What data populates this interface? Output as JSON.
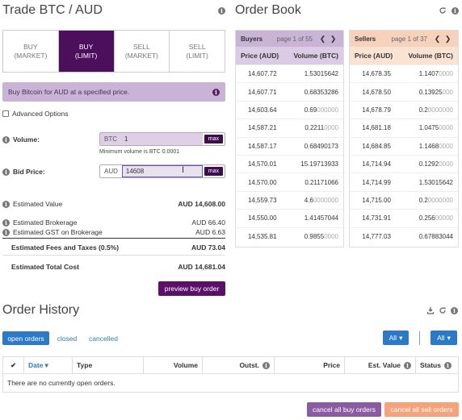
{
  "trade": {
    "title": "Trade BTC / AUD",
    "tabs": [
      {
        "line1": "BUY",
        "line2": "(MARKET)"
      },
      {
        "line1": "BUY",
        "line2": "(LIMIT)"
      },
      {
        "line1": "SELL",
        "line2": "(MARKET)"
      },
      {
        "line1": "SELL",
        "line2": "(LIMIT)"
      }
    ],
    "alert_text": "Buy Bitcoin for AUD at a specified price.",
    "advanced_options_label": "Advanced Options",
    "volume": {
      "label": "Volume:",
      "currency": "BTC",
      "value": "1",
      "max_label": "max",
      "hint": "Minimum volume is BTC 0.0001"
    },
    "bid_price": {
      "label": "Bid Price:",
      "currency": "AUD",
      "value": "14608",
      "max_label": "max"
    },
    "estimated_value": {
      "label": "Estimated Value",
      "value": "AUD 14,608.00"
    },
    "estimated_brokerage": {
      "label": "Estimated Brokerage",
      "value": "AUD 66.40"
    },
    "estimated_gst": {
      "label": "Estimated GST on Brokerage",
      "value": "AUD 6.63"
    },
    "estimated_fees": {
      "label": "Estimated Fees and Taxes (0.5%)",
      "value": "AUD 73.04"
    },
    "estimated_total": {
      "label": "Estimated Total Cost",
      "value": "AUD 14,681.04"
    },
    "preview_button": "preview buy order"
  },
  "order_book": {
    "title": "Order Book",
    "buyers": {
      "title": "Buyers",
      "page": "page 1 of 55",
      "col_price": "Price (AUD)",
      "col_volume": "Volume (BTC)",
      "rows": [
        {
          "price": "14,607.72",
          "vol": "1.53015642",
          "vol_dim": ""
        },
        {
          "price": "14,607.71",
          "vol": "0.68353286",
          "vol_dim": ""
        },
        {
          "price": "14,603.64",
          "vol": "0.69",
          "vol_dim": "000000"
        },
        {
          "price": "14,587.21",
          "vol": "0.2211",
          "vol_dim": "0000"
        },
        {
          "price": "14,587.17",
          "vol": "0.68490173",
          "vol_dim": ""
        },
        {
          "price": "14,570.01",
          "vol": "15.19713933",
          "vol_dim": ""
        },
        {
          "price": "14,570.00",
          "vol": "0.21171066",
          "vol_dim": ""
        },
        {
          "price": "14,559.73",
          "vol": "4.6",
          "vol_dim": "0000000"
        },
        {
          "price": "14,550.00",
          "vol": "1.41457044",
          "vol_dim": ""
        },
        {
          "price": "14,535.81",
          "vol": "0.9855",
          "vol_dim": "0000"
        }
      ]
    },
    "sellers": {
      "title": "Sellers",
      "page": "page 1 of 37",
      "col_price": "Price (AUD)",
      "col_volume": "Volume (BTC)",
      "rows": [
        {
          "price": "14,678.35",
          "vol": "1.1407",
          "vol_dim": "0000"
        },
        {
          "price": "14,678.50",
          "vol": "0.13925",
          "vol_dim": "000"
        },
        {
          "price": "14,678.79",
          "vol": "0.2",
          "vol_dim": "0000000"
        },
        {
          "price": "14,681.18",
          "vol": "1.0475",
          "vol_dim": "0000"
        },
        {
          "price": "14,684.85",
          "vol": "1.1468",
          "vol_dim": "0000"
        },
        {
          "price": "14,714.94",
          "vol": "0.1292",
          "vol_dim": "0000"
        },
        {
          "price": "14,714.99",
          "vol": "1.53015642",
          "vol_dim": ""
        },
        {
          "price": "14,715.00",
          "vol": "0.2",
          "vol_dim": "0000000"
        },
        {
          "price": "14,731.91",
          "vol": "0.256",
          "vol_dim": "00000"
        },
        {
          "price": "14,777.03",
          "vol": "0.67883044",
          "vol_dim": ""
        }
      ]
    }
  },
  "history": {
    "title": "Order History",
    "tabs": [
      "open orders",
      "closed",
      "cancelled"
    ],
    "filter1": "All",
    "filter2": "All",
    "columns": [
      "Date",
      "Type",
      "Volume",
      "Outst.",
      "Price",
      "Est. Value",
      "Status"
    ],
    "empty_text": "There are no currently open orders.",
    "cancel_buy": "cancel all buy orders",
    "cancel_sell": "cancel all sell orders"
  }
}
